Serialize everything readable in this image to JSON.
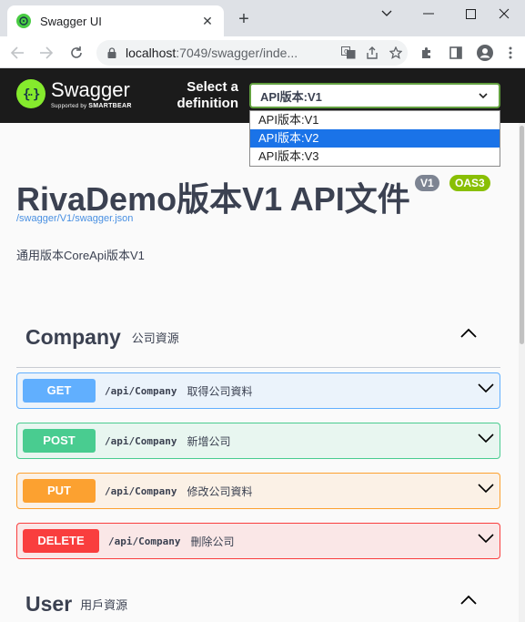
{
  "browser": {
    "tab_title": "Swagger UI",
    "url_host": "localhost",
    "url_rest": ":7049/swagger/inde..."
  },
  "topbar": {
    "logo_name": "Swagger",
    "logo_sub_prefix": "Supported by ",
    "logo_sub_brand": "SMARTBEAR",
    "select_label": "Select a definition",
    "selected_definition": "API版本:V1",
    "options": [
      "API版本:V1",
      "API版本:V2",
      "API版本:V3"
    ],
    "highlighted_option": "API版本:V2"
  },
  "info": {
    "title": "RivaDemo版本V1 API文件",
    "version_badge": "V1",
    "oas_badge": "OAS3",
    "spec_url": "/swagger/V1/swagger.json",
    "description": "通用版本CoreApi版本V1"
  },
  "tags": [
    {
      "name": "Company",
      "description": "公司資源",
      "operations": [
        {
          "method": "GET",
          "path": "/api/Company",
          "summary": "取得公司資料"
        },
        {
          "method": "POST",
          "path": "/api/Company",
          "summary": "新增公司"
        },
        {
          "method": "PUT",
          "path": "/api/Company",
          "summary": "修改公司資料"
        },
        {
          "method": "DELETE",
          "path": "/api/Company",
          "summary": "刪除公司"
        }
      ]
    },
    {
      "name": "User",
      "description": "用戶資源"
    }
  ],
  "colors": {
    "get": "#61affe",
    "post": "#49cc90",
    "put": "#fca130",
    "delete": "#f93e3e",
    "select_border": "#62a03f",
    "topbar_bg": "#1b1b1b"
  }
}
